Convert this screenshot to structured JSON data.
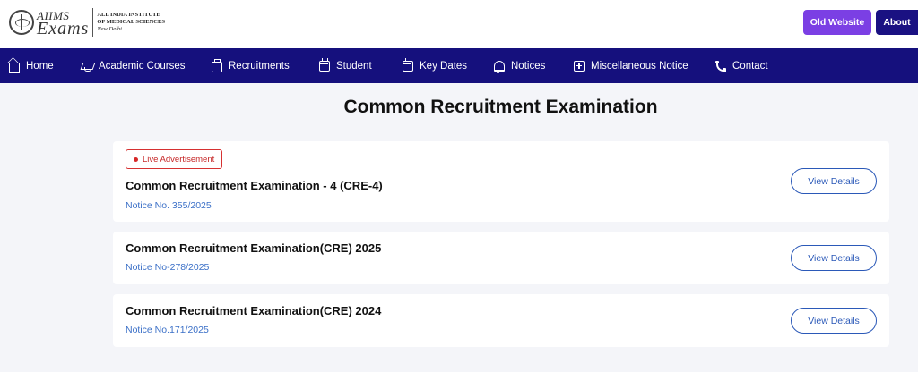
{
  "brand": {
    "logo_line1": "AIIMS",
    "logo_line2": "Exams",
    "institute_line1": "ALL INDIA INSTITUTE",
    "institute_line2": "OF MEDICAL SCIENCES",
    "institute_line3": "New Delhi"
  },
  "header": {
    "old_website_label": "Old Website",
    "about_label": "About"
  },
  "nav": {
    "items": [
      {
        "label": "Home",
        "icon": "home-icon"
      },
      {
        "label": "Academic Courses",
        "icon": "graduation-cap-icon"
      },
      {
        "label": "Recruitments",
        "icon": "briefcase-icon"
      },
      {
        "label": "Student",
        "icon": "calendar-icon"
      },
      {
        "label": "Key Dates",
        "icon": "calendar-check-icon"
      },
      {
        "label": "Notices",
        "icon": "bell-icon"
      },
      {
        "label": "Miscellaneous Notice",
        "icon": "plus-square-icon"
      },
      {
        "label": "Contact",
        "icon": "phone-icon"
      }
    ]
  },
  "main": {
    "title": "Common Recruitment Examination",
    "cards": [
      {
        "badge": "Live Advertisement",
        "title": "Common Recruitment Examination - 4 (CRE-4)",
        "notice": "Notice No. 355/2025",
        "button": "View Details"
      },
      {
        "title": "Common Recruitment Examination(CRE) 2025",
        "notice": "Notice No-278/2025",
        "button": "View Details"
      },
      {
        "title": "Common Recruitment Examination(CRE) 2024",
        "notice": "Notice No.171/2025",
        "button": "View Details"
      }
    ]
  },
  "colors": {
    "nav_bg": "#15107d",
    "old_website_bg": "#7b3fe4",
    "about_bg": "#1a1182",
    "live_badge": "#d63131",
    "notice_text": "#3a6fc7",
    "page_bg": "#f4f5f9"
  }
}
